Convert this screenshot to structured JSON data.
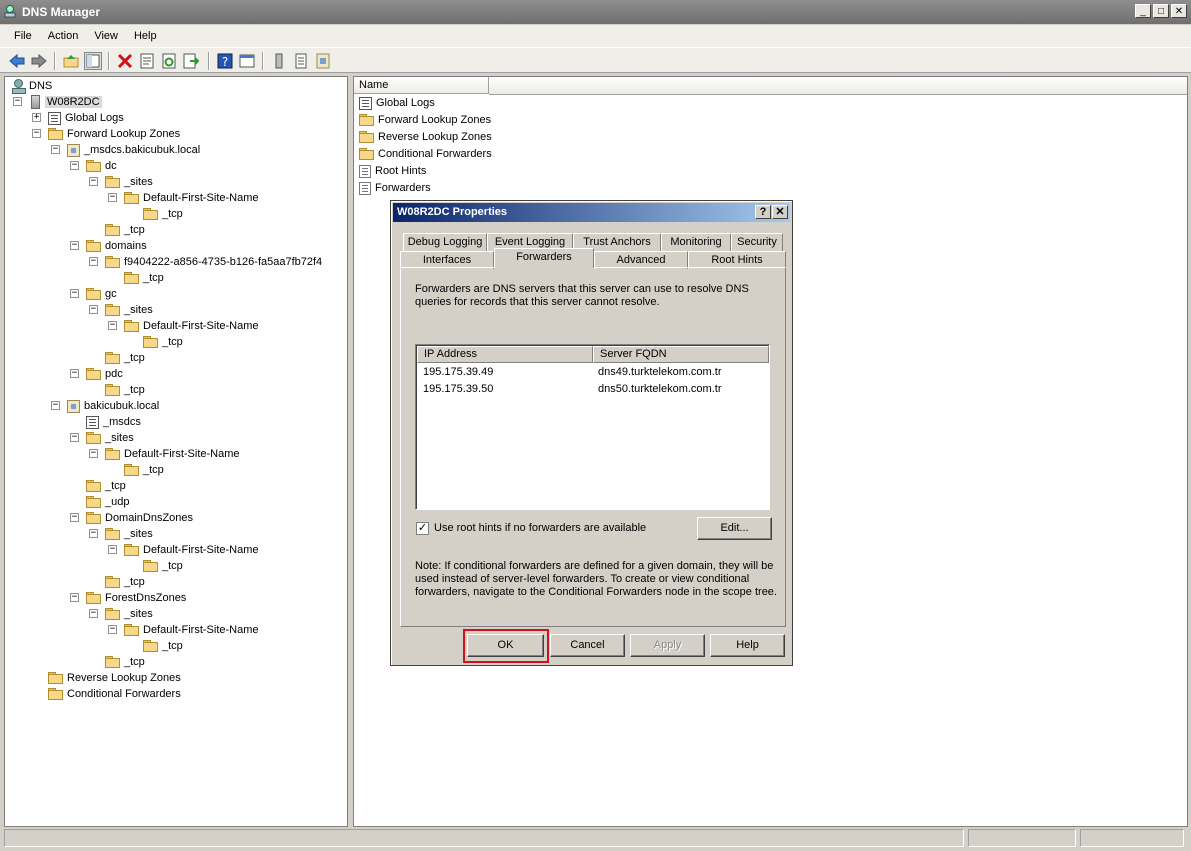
{
  "window": {
    "title": "DNS Manager",
    "min_glyph": "_",
    "max_glyph": "□",
    "close_glyph": "✕"
  },
  "menu": [
    "File",
    "Action",
    "View",
    "Help"
  ],
  "tree": {
    "root": "DNS",
    "server": "W08R2DC",
    "global_logs": "Global Logs",
    "forward_zones": "Forward Lookup Zones",
    "msdcs_zone": "_msdcs.bakicubuk.local",
    "dc": "dc",
    "sites": "_sites",
    "default_site": "Default-First-Site-Name",
    "tcp": "_tcp",
    "domains": "domains",
    "domain_guid": "f9404222-a856-4735-b126-fa5aa7fb72f4",
    "gc": "gc",
    "pdc": "pdc",
    "bakicubuk_zone": "bakicubuk.local",
    "msdcs": "_msdcs",
    "udp": "_udp",
    "domain_dns_zones": "DomainDnsZones",
    "forest_dns_zones": "ForestDnsZones",
    "reverse_zones": "Reverse Lookup Zones",
    "conditional_forwarders": "Conditional Forwarders",
    "expand_minus": "−",
    "expand_plus": "+"
  },
  "list": {
    "column_name": "Name",
    "items": [
      "Global Logs",
      "Forward Lookup Zones",
      "Reverse Lookup Zones",
      "Conditional Forwarders",
      "Root Hints",
      "Forwarders"
    ]
  },
  "dialog": {
    "title": "W08R2DC Properties",
    "help_glyph": "?",
    "close_glyph": "✕",
    "tabs_row1": [
      "Debug Logging",
      "Event Logging",
      "Trust Anchors",
      "Monitoring",
      "Security"
    ],
    "tabs_row2": [
      "Interfaces",
      "Forwarders",
      "Advanced",
      "Root Hints"
    ],
    "active_tab": "Forwarders",
    "description_line1": "Forwarders are DNS servers that this server can use to resolve DNS",
    "description_line2": "queries for records that this server cannot resolve.",
    "columns": [
      "IP Address",
      "Server FQDN"
    ],
    "rows": [
      {
        "ip": "195.175.39.49",
        "fqdn": "dns49.turktelekom.com.tr"
      },
      {
        "ip": "195.175.39.50",
        "fqdn": "dns50.turktelekom.com.tr"
      }
    ],
    "checkbox_label": "Use root hints if no forwarders are available",
    "checkbox_mark": "✓",
    "edit_button": "Edit...",
    "note_line1": "Note: If conditional forwarders are defined for a given domain, they will be",
    "note_line2": "used instead of server-level forwarders.  To create or view conditional",
    "note_line3": "forwarders, navigate to the Conditional Forwarders node in the scope tree.",
    "buttons": {
      "ok": "OK",
      "cancel": "Cancel",
      "apply": "Apply",
      "help": "Help"
    }
  },
  "colors": {
    "highlight": "#d0131b",
    "dialog_title": "#0a246a"
  }
}
